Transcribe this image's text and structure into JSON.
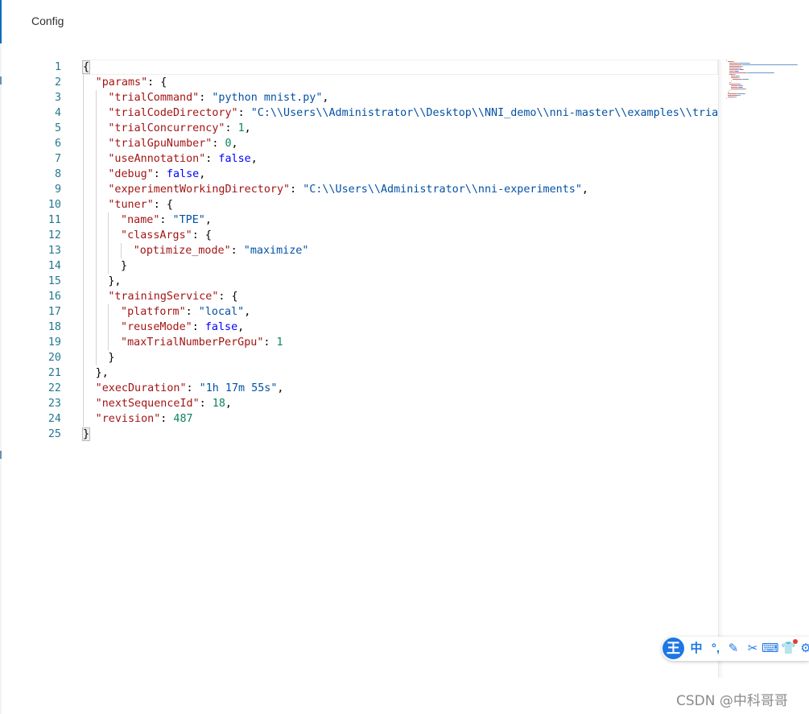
{
  "page": {
    "title": "Config"
  },
  "editor": {
    "lines": [
      {
        "num": "1",
        "indent": 0,
        "parts": [
          [
            "p",
            "{"
          ]
        ]
      },
      {
        "num": "2",
        "indent": 1,
        "parts": [
          [
            "k",
            "\"params\""
          ],
          [
            "p",
            ": {"
          ]
        ]
      },
      {
        "num": "3",
        "indent": 2,
        "parts": [
          [
            "k",
            "\"trialCommand\""
          ],
          [
            "p",
            ": "
          ],
          [
            "s",
            "\"python mnist.py\""
          ],
          [
            "p",
            ","
          ]
        ]
      },
      {
        "num": "4",
        "indent": 2,
        "parts": [
          [
            "k",
            "\"trialCodeDirectory\""
          ],
          [
            "p",
            ": "
          ],
          [
            "s",
            "\"C:\\\\Users\\\\Administrator\\\\Desktop\\\\NNI_demo\\\\nni-master\\\\examples\\\\trials\\\\mnist-pytorch\""
          ],
          [
            "p",
            ","
          ]
        ]
      },
      {
        "num": "5",
        "indent": 2,
        "parts": [
          [
            "k",
            "\"trialConcurrency\""
          ],
          [
            "p",
            ": "
          ],
          [
            "n",
            "1"
          ],
          [
            "p",
            ","
          ]
        ]
      },
      {
        "num": "6",
        "indent": 2,
        "parts": [
          [
            "k",
            "\"trialGpuNumber\""
          ],
          [
            "p",
            ": "
          ],
          [
            "n",
            "0"
          ],
          [
            "p",
            ","
          ]
        ]
      },
      {
        "num": "7",
        "indent": 2,
        "parts": [
          [
            "k",
            "\"useAnnotation\""
          ],
          [
            "p",
            ": "
          ],
          [
            "b",
            "false"
          ],
          [
            "p",
            ","
          ]
        ]
      },
      {
        "num": "8",
        "indent": 2,
        "parts": [
          [
            "k",
            "\"debug\""
          ],
          [
            "p",
            ": "
          ],
          [
            "b",
            "false"
          ],
          [
            "p",
            ","
          ]
        ]
      },
      {
        "num": "9",
        "indent": 2,
        "parts": [
          [
            "k",
            "\"experimentWorkingDirectory\""
          ],
          [
            "p",
            ": "
          ],
          [
            "s",
            "\"C:\\\\Users\\\\Administrator\\\\nni-experiments\""
          ],
          [
            "p",
            ","
          ]
        ]
      },
      {
        "num": "10",
        "indent": 2,
        "parts": [
          [
            "k",
            "\"tuner\""
          ],
          [
            "p",
            ": {"
          ]
        ]
      },
      {
        "num": "11",
        "indent": 3,
        "parts": [
          [
            "k",
            "\"name\""
          ],
          [
            "p",
            ": "
          ],
          [
            "s",
            "\"TPE\""
          ],
          [
            "p",
            ","
          ]
        ]
      },
      {
        "num": "12",
        "indent": 3,
        "parts": [
          [
            "k",
            "\"classArgs\""
          ],
          [
            "p",
            ": {"
          ]
        ]
      },
      {
        "num": "13",
        "indent": 4,
        "parts": [
          [
            "k",
            "\"optimize_mode\""
          ],
          [
            "p",
            ": "
          ],
          [
            "s",
            "\"maximize\""
          ]
        ]
      },
      {
        "num": "14",
        "indent": 3,
        "parts": [
          [
            "p",
            "}"
          ]
        ]
      },
      {
        "num": "15",
        "indent": 2,
        "parts": [
          [
            "p",
            "},"
          ]
        ]
      },
      {
        "num": "16",
        "indent": 2,
        "parts": [
          [
            "k",
            "\"trainingService\""
          ],
          [
            "p",
            ": {"
          ]
        ]
      },
      {
        "num": "17",
        "indent": 3,
        "parts": [
          [
            "k",
            "\"platform\""
          ],
          [
            "p",
            ": "
          ],
          [
            "s",
            "\"local\""
          ],
          [
            "p",
            ","
          ]
        ]
      },
      {
        "num": "18",
        "indent": 3,
        "parts": [
          [
            "k",
            "\"reuseMode\""
          ],
          [
            "p",
            ": "
          ],
          [
            "b",
            "false"
          ],
          [
            "p",
            ","
          ]
        ]
      },
      {
        "num": "19",
        "indent": 3,
        "parts": [
          [
            "k",
            "\"maxTrialNumberPerGpu\""
          ],
          [
            "p",
            ": "
          ],
          [
            "n",
            "1"
          ]
        ]
      },
      {
        "num": "20",
        "indent": 2,
        "parts": [
          [
            "p",
            "}"
          ]
        ]
      },
      {
        "num": "21",
        "indent": 1,
        "parts": [
          [
            "p",
            "},"
          ]
        ]
      },
      {
        "num": "22",
        "indent": 1,
        "parts": [
          [
            "k",
            "\"execDuration\""
          ],
          [
            "p",
            ": "
          ],
          [
            "s",
            "\"1h 17m 55s\""
          ],
          [
            "p",
            ","
          ]
        ]
      },
      {
        "num": "23",
        "indent": 1,
        "parts": [
          [
            "k",
            "\"nextSequenceId\""
          ],
          [
            "p",
            ": "
          ],
          [
            "n",
            "18"
          ],
          [
            "p",
            ","
          ]
        ]
      },
      {
        "num": "24",
        "indent": 1,
        "parts": [
          [
            "k",
            "\"revision\""
          ],
          [
            "p",
            ": "
          ],
          [
            "n",
            "487"
          ]
        ]
      },
      {
        "num": "25",
        "indent": 0,
        "parts": [
          [
            "p",
            "}"
          ]
        ]
      }
    ]
  },
  "ime_toolbar": {
    "logo": "王",
    "items": [
      {
        "name": "chinese-mode-button",
        "label": "中"
      },
      {
        "name": "punctuation-button",
        "label": "°,"
      },
      {
        "name": "handwriting-icon",
        "label": "✎"
      },
      {
        "name": "scissors-icon",
        "label": "✂"
      },
      {
        "name": "keyboard-icon",
        "label": "⌨"
      },
      {
        "name": "skin-icon",
        "label": "👕"
      },
      {
        "name": "settings-icon",
        "label": "⚙"
      }
    ]
  },
  "colors": {
    "key": "#a31515",
    "string": "#0451a5",
    "number": "#098658",
    "boolean": "#0000ff",
    "line_number": "#237893",
    "accent": "#0f6cbd"
  },
  "watermark": "CSDN @中科哥哥"
}
